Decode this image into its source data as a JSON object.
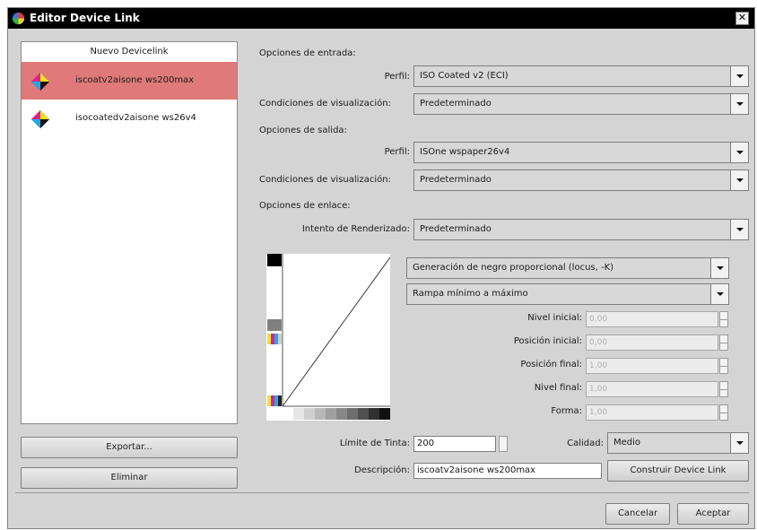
{
  "window": {
    "title": "Editor Device Link"
  },
  "list": {
    "header": "Nuevo Devicelink",
    "items": [
      {
        "label": "iscoatv2aisone ws200max",
        "selected": true
      },
      {
        "label": "isocoatedv2aisone ws26v4",
        "selected": false
      }
    ]
  },
  "left_buttons": {
    "export": "Exportar...",
    "delete": "Eliminar"
  },
  "input_options": {
    "section": "Opciones de entrada:",
    "profile_label": "Perfil:",
    "profile_value": "ISO Coated v2 (ECI)",
    "view_label": "Condiciones de visualización:",
    "view_value": "Predeterminado"
  },
  "output_options": {
    "section": "Opciones de salida:",
    "profile_label": "Perfil:",
    "profile_value": "ISOne wspaper26v4",
    "view_label": "Condiciones de visualización:",
    "view_value": "Predeterminado"
  },
  "link_options": {
    "section": "Opciones de enlace:",
    "intent_label": "Intento de Renderizado:",
    "intent_value": "Predeterminado"
  },
  "black": {
    "generation": "Generación de negro proporcional (locus, -K)",
    "ramp": "Rampa mínimo a máximo",
    "fields": [
      {
        "label": "Nivel inicial:",
        "value": "0,00"
      },
      {
        "label": "Posición inicial:",
        "value": "0,00"
      },
      {
        "label": "Posición final:",
        "value": "1,00"
      },
      {
        "label": "Nivel final:",
        "value": "1,00"
      },
      {
        "label": "Forma:",
        "value": "1,00"
      }
    ]
  },
  "ink": {
    "label": "Límite de Tinta:",
    "value": "200"
  },
  "quality": {
    "label": "Calidad:",
    "value": "Medio"
  },
  "description": {
    "label": "Descripción:",
    "value": "iscoatv2aisone ws200max"
  },
  "build_button": "Construir Device Link",
  "footer": {
    "cancel": "Cancelar",
    "accept": "Aceptar"
  },
  "colors": {
    "selection": "#e07a7a",
    "titlebar": "#000000",
    "dialog": "#d4d4d4"
  }
}
